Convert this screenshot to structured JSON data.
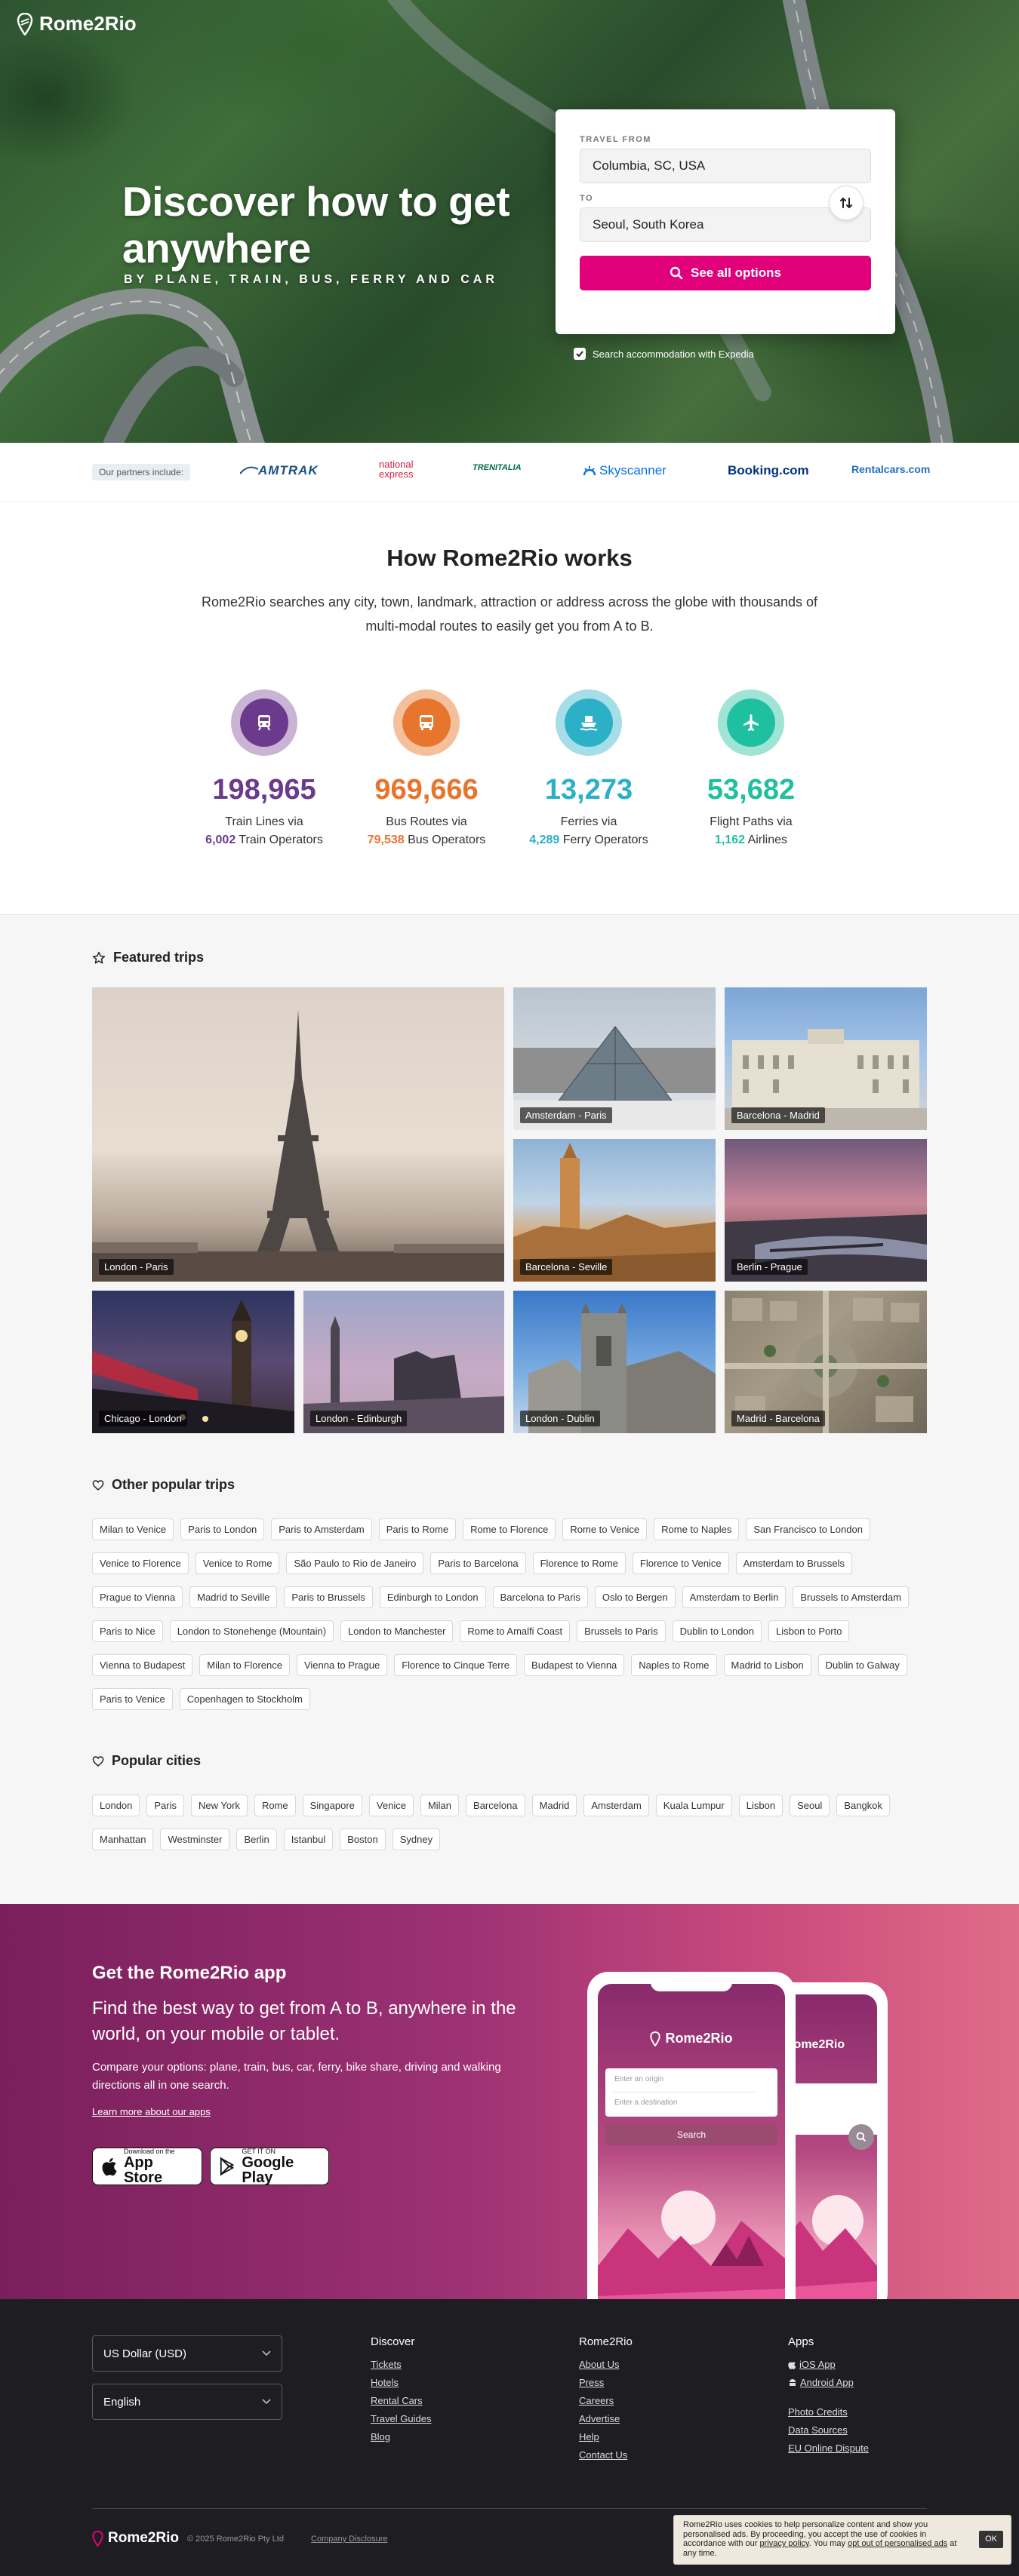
{
  "header": {
    "logo_text": "Rome2Rio"
  },
  "hero": {
    "title": "Discover how to get anywhere",
    "subtitle": "BY PLANE, TRAIN, BUS, FERRY AND CAR"
  },
  "search": {
    "from_label": "TRAVEL FROM",
    "from_value": "Columbia, SC, USA",
    "to_label": "TO",
    "to_value": "Seoul, South Korea",
    "button_label": "See all options",
    "accommodation_label": "Search accommodation with Expedia",
    "accommodation_checked": true,
    "accent_color": "#e2007a"
  },
  "partners": {
    "label": "Our partners include:",
    "logos": [
      "AMTRAK",
      "national express",
      "TRENITALIA",
      "Skyscanner",
      "Booking.com",
      "Rentalcars.com"
    ]
  },
  "how": {
    "title": "How Rome2Rio works",
    "text": "Rome2Rio searches any city, town, landmark, attraction or address across the globe with thousands of multi-modal routes to easily get you from A to B.",
    "stats": [
      {
        "icon": "train-icon",
        "number": "198,965",
        "line1": "Train Lines via",
        "count": "6,002",
        "unit": "Train Operators",
        "color": "#6b3a8c",
        "light": "#c9b4d6"
      },
      {
        "icon": "bus-icon",
        "number": "969,666",
        "line1": "Bus Routes via",
        "count": "79,538",
        "unit": "Bus Operators",
        "color": "#e8752e",
        "light": "#f4c09c"
      },
      {
        "icon": "ferry-icon",
        "number": "13,273",
        "line1": "Ferries via",
        "count": "4,289",
        "unit": "Ferry Operators",
        "color": "#2bb0c8",
        "light": "#a5dde8"
      },
      {
        "icon": "plane-icon",
        "number": "53,682",
        "line1": "Flight Paths via",
        "count": "1,162",
        "unit": "Airlines",
        "color": "#1fc0a0",
        "light": "#9fe4d5"
      }
    ]
  },
  "featured": {
    "title": "Featured trips",
    "trips": [
      "London - Paris",
      "Amsterdam - Paris",
      "Barcelona - Madrid",
      "Barcelona - Seville",
      "Berlin - Prague",
      "Chicago - London",
      "London - Edinburgh",
      "London - Dublin",
      "Madrid - Barcelona"
    ]
  },
  "popular_trips": {
    "title": "Other popular trips",
    "items": [
      "Milan to Venice",
      "Paris to London",
      "Paris to Amsterdam",
      "Paris to Rome",
      "Rome to Florence",
      "Rome to Venice",
      "Rome to Naples",
      "San Francisco to London",
      "Venice to Florence",
      "Venice to Rome",
      "São Paulo to Rio de Janeiro",
      "Paris to Barcelona",
      "Florence to Rome",
      "Florence to Venice",
      "Amsterdam to Brussels",
      "Prague to Vienna",
      "Madrid to Seville",
      "Paris to Brussels",
      "Edinburgh to London",
      "Barcelona to Paris",
      "Oslo to Bergen",
      "Amsterdam to Berlin",
      "Brussels to Amsterdam",
      "Paris to Nice",
      "London to Stonehenge (Mountain)",
      "London to Manchester",
      "Rome to Amalfi Coast",
      "Brussels to Paris",
      "Dublin to London",
      "Lisbon to Porto",
      "Vienna to Budapest",
      "Milan to Florence",
      "Vienna to Prague",
      "Florence to Cinque Terre",
      "Budapest to Vienna",
      "Naples to Rome",
      "Madrid to Lisbon",
      "Dublin to Galway",
      "Paris to Venice",
      "Copenhagen to Stockholm"
    ]
  },
  "popular_cities": {
    "title": "Popular cities",
    "items": [
      "London",
      "Paris",
      "New York",
      "Rome",
      "Singapore",
      "Venice",
      "Milan",
      "Barcelona",
      "Madrid",
      "Amsterdam",
      "Kuala Lumpur",
      "Lisbon",
      "Seoul",
      "Bangkok",
      "Manhattan",
      "Westminster",
      "Berlin",
      "Istanbul",
      "Boston",
      "Sydney"
    ]
  },
  "app": {
    "title": "Get the Rome2Rio app",
    "lead": "Find the best way to get from A to B, anywhere in the world, on your mobile or tablet.",
    "desc": "Compare your options: plane, train, bus, car, ferry, bike share, driving and walking directions all in one search.",
    "link": "Learn more about our apps",
    "appstore_small": "Download on the",
    "appstore_big": "App Store",
    "play_small": "GET IT ON",
    "play_big": "Google Play",
    "phone": {
      "logo": "Rome2Rio",
      "origin_placeholder": "Enter an origin",
      "dest_placeholder": "Enter a destination",
      "search_label": "Search"
    }
  },
  "footer": {
    "currency": "US Dollar (USD)",
    "language": "English",
    "cols": [
      {
        "title": "Discover",
        "links": [
          "Tickets",
          "Hotels",
          "Rental Cars",
          "Travel Guides",
          "Blog"
        ]
      },
      {
        "title": "Rome2Rio",
        "links": [
          "About Us",
          "Press",
          "Careers",
          "Advertise",
          "Help",
          "Contact Us"
        ]
      },
      {
        "title": "Apps",
        "links": [
          "iOS App",
          "Android App"
        ],
        "extra": [
          "Photo Credits",
          "Data Sources",
          "EU Online Dispute"
        ]
      }
    ],
    "logo_text": "Rome2Rio",
    "copyright": "© 2025 Rome2Rio Pty Ltd",
    "disclosure": "Company Disclosure"
  },
  "cookie": {
    "text_before": "Rome2Rio uses cookies to help personalize content and show you personalised ads. By proceeding, you accept the use of cookies in accordance with our ",
    "privacy": "privacy policy",
    "text_mid": ". You may ",
    "optout": "opt out of personalised ads",
    "text_after": " at any time.",
    "ok": "OK"
  }
}
